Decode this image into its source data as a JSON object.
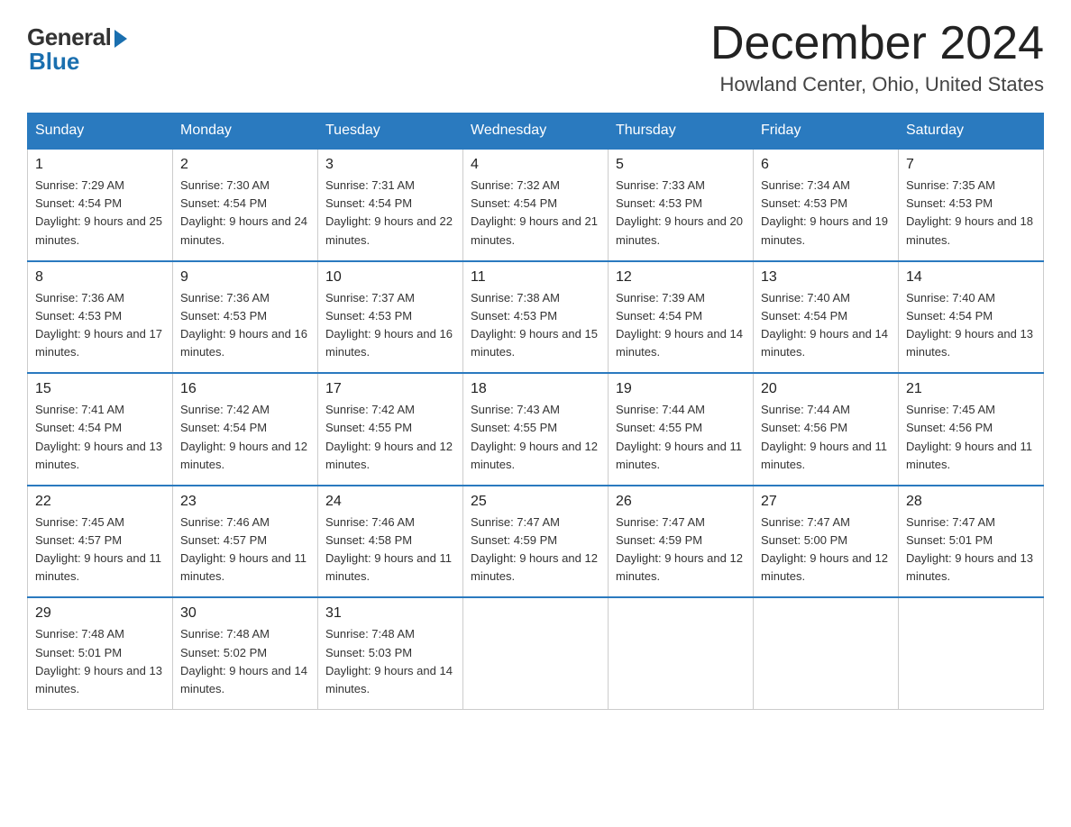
{
  "logo": {
    "general": "General",
    "blue": "Blue"
  },
  "title": "December 2024",
  "location": "Howland Center, Ohio, United States",
  "days_of_week": [
    "Sunday",
    "Monday",
    "Tuesday",
    "Wednesday",
    "Thursday",
    "Friday",
    "Saturday"
  ],
  "weeks": [
    [
      {
        "num": "1",
        "sunrise": "7:29 AM",
        "sunset": "4:54 PM",
        "daylight": "9 hours and 25 minutes."
      },
      {
        "num": "2",
        "sunrise": "7:30 AM",
        "sunset": "4:54 PM",
        "daylight": "9 hours and 24 minutes."
      },
      {
        "num": "3",
        "sunrise": "7:31 AM",
        "sunset": "4:54 PM",
        "daylight": "9 hours and 22 minutes."
      },
      {
        "num": "4",
        "sunrise": "7:32 AM",
        "sunset": "4:54 PM",
        "daylight": "9 hours and 21 minutes."
      },
      {
        "num": "5",
        "sunrise": "7:33 AM",
        "sunset": "4:53 PM",
        "daylight": "9 hours and 20 minutes."
      },
      {
        "num": "6",
        "sunrise": "7:34 AM",
        "sunset": "4:53 PM",
        "daylight": "9 hours and 19 minutes."
      },
      {
        "num": "7",
        "sunrise": "7:35 AM",
        "sunset": "4:53 PM",
        "daylight": "9 hours and 18 minutes."
      }
    ],
    [
      {
        "num": "8",
        "sunrise": "7:36 AM",
        "sunset": "4:53 PM",
        "daylight": "9 hours and 17 minutes."
      },
      {
        "num": "9",
        "sunrise": "7:36 AM",
        "sunset": "4:53 PM",
        "daylight": "9 hours and 16 minutes."
      },
      {
        "num": "10",
        "sunrise": "7:37 AM",
        "sunset": "4:53 PM",
        "daylight": "9 hours and 16 minutes."
      },
      {
        "num": "11",
        "sunrise": "7:38 AM",
        "sunset": "4:53 PM",
        "daylight": "9 hours and 15 minutes."
      },
      {
        "num": "12",
        "sunrise": "7:39 AM",
        "sunset": "4:54 PM",
        "daylight": "9 hours and 14 minutes."
      },
      {
        "num": "13",
        "sunrise": "7:40 AM",
        "sunset": "4:54 PM",
        "daylight": "9 hours and 14 minutes."
      },
      {
        "num": "14",
        "sunrise": "7:40 AM",
        "sunset": "4:54 PM",
        "daylight": "9 hours and 13 minutes."
      }
    ],
    [
      {
        "num": "15",
        "sunrise": "7:41 AM",
        "sunset": "4:54 PM",
        "daylight": "9 hours and 13 minutes."
      },
      {
        "num": "16",
        "sunrise": "7:42 AM",
        "sunset": "4:54 PM",
        "daylight": "9 hours and 12 minutes."
      },
      {
        "num": "17",
        "sunrise": "7:42 AM",
        "sunset": "4:55 PM",
        "daylight": "9 hours and 12 minutes."
      },
      {
        "num": "18",
        "sunrise": "7:43 AM",
        "sunset": "4:55 PM",
        "daylight": "9 hours and 12 minutes."
      },
      {
        "num": "19",
        "sunrise": "7:44 AM",
        "sunset": "4:55 PM",
        "daylight": "9 hours and 11 minutes."
      },
      {
        "num": "20",
        "sunrise": "7:44 AM",
        "sunset": "4:56 PM",
        "daylight": "9 hours and 11 minutes."
      },
      {
        "num": "21",
        "sunrise": "7:45 AM",
        "sunset": "4:56 PM",
        "daylight": "9 hours and 11 minutes."
      }
    ],
    [
      {
        "num": "22",
        "sunrise": "7:45 AM",
        "sunset": "4:57 PM",
        "daylight": "9 hours and 11 minutes."
      },
      {
        "num": "23",
        "sunrise": "7:46 AM",
        "sunset": "4:57 PM",
        "daylight": "9 hours and 11 minutes."
      },
      {
        "num": "24",
        "sunrise": "7:46 AM",
        "sunset": "4:58 PM",
        "daylight": "9 hours and 11 minutes."
      },
      {
        "num": "25",
        "sunrise": "7:47 AM",
        "sunset": "4:59 PM",
        "daylight": "9 hours and 12 minutes."
      },
      {
        "num": "26",
        "sunrise": "7:47 AM",
        "sunset": "4:59 PM",
        "daylight": "9 hours and 12 minutes."
      },
      {
        "num": "27",
        "sunrise": "7:47 AM",
        "sunset": "5:00 PM",
        "daylight": "9 hours and 12 minutes."
      },
      {
        "num": "28",
        "sunrise": "7:47 AM",
        "sunset": "5:01 PM",
        "daylight": "9 hours and 13 minutes."
      }
    ],
    [
      {
        "num": "29",
        "sunrise": "7:48 AM",
        "sunset": "5:01 PM",
        "daylight": "9 hours and 13 minutes."
      },
      {
        "num": "30",
        "sunrise": "7:48 AM",
        "sunset": "5:02 PM",
        "daylight": "9 hours and 14 minutes."
      },
      {
        "num": "31",
        "sunrise": "7:48 AM",
        "sunset": "5:03 PM",
        "daylight": "9 hours and 14 minutes."
      },
      null,
      null,
      null,
      null
    ]
  ]
}
